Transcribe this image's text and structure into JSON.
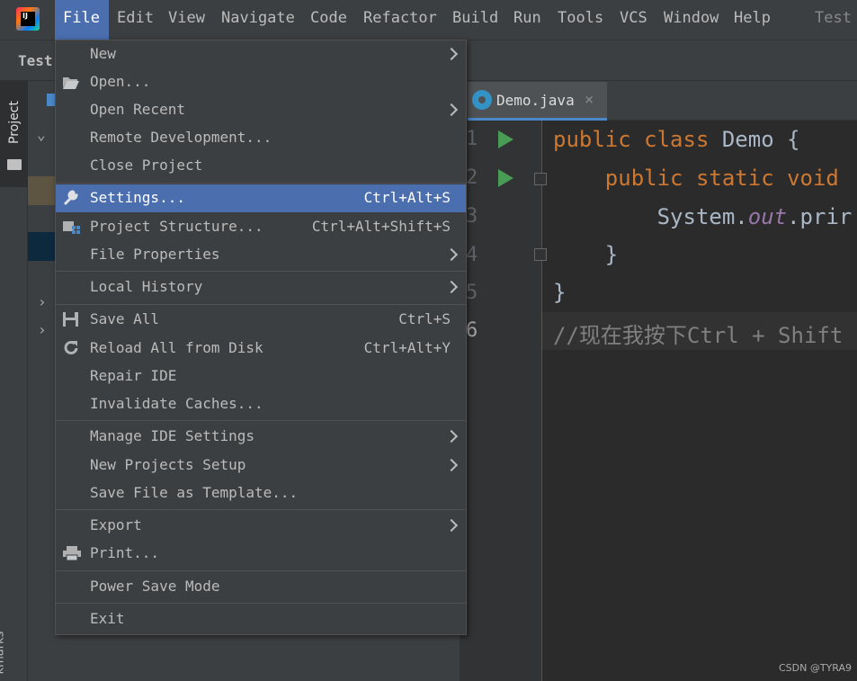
{
  "menubar": {
    "items": [
      "File",
      "Edit",
      "View",
      "Navigate",
      "Code",
      "Refactor",
      "Build",
      "Run",
      "Tools",
      "VCS",
      "Window",
      "Help"
    ],
    "project_name": "Test"
  },
  "toolbar": {
    "title": "Test"
  },
  "sidebar": {
    "project_tab": "Project",
    "bookmarks_tab": "kmarks"
  },
  "editor": {
    "tab": {
      "label": "Demo.java",
      "close": "×"
    },
    "line_numbers": [
      "1",
      "2",
      "3",
      "4",
      "5",
      "6"
    ],
    "code_tokens": {
      "l1_kw": "public class ",
      "l1_rest": "Demo {",
      "l2_kw": "    public static void",
      "l3_a": "        System.",
      "l3_field": "out",
      "l3_b": ".prir",
      "l4": "    }",
      "l5": "}",
      "l6_comment": "//现在我按下Ctrl + Shift"
    }
  },
  "file_menu": {
    "items": [
      {
        "label": "New",
        "shortcut": ""
      },
      {
        "label": "Open...",
        "shortcut": ""
      },
      {
        "label": "Open Recent",
        "shortcut": ""
      },
      {
        "label": "Remote Development...",
        "shortcut": ""
      },
      {
        "label": "Close Project",
        "shortcut": ""
      },
      {
        "label": "Settings...",
        "shortcut": "Ctrl+Alt+S"
      },
      {
        "label": "Project Structure...",
        "shortcut": "Ctrl+Alt+Shift+S"
      },
      {
        "label": "File Properties",
        "shortcut": ""
      },
      {
        "label": "Local History",
        "shortcut": ""
      },
      {
        "label": "Save All",
        "shortcut": "Ctrl+S"
      },
      {
        "label": "Reload All from Disk",
        "shortcut": "Ctrl+Alt+Y"
      },
      {
        "label": "Repair IDE",
        "shortcut": ""
      },
      {
        "label": "Invalidate Caches...",
        "shortcut": ""
      },
      {
        "label": "Manage IDE Settings",
        "shortcut": ""
      },
      {
        "label": "New Projects Setup",
        "shortcut": ""
      },
      {
        "label": "Save File as Template...",
        "shortcut": ""
      },
      {
        "label": "Export",
        "shortcut": ""
      },
      {
        "label": "Print...",
        "shortcut": ""
      },
      {
        "label": "Power Save Mode",
        "shortcut": ""
      },
      {
        "label": "Exit",
        "shortcut": ""
      }
    ],
    "highlighted": "Settings..."
  },
  "watermark": "CSDN @TYRA9",
  "colors": {
    "accent": "#4b6eaf",
    "menu_bg": "#3c3f41",
    "editor_bg": "#2b2b2b",
    "keyword": "#cc7832",
    "run_green": "#499c54"
  }
}
